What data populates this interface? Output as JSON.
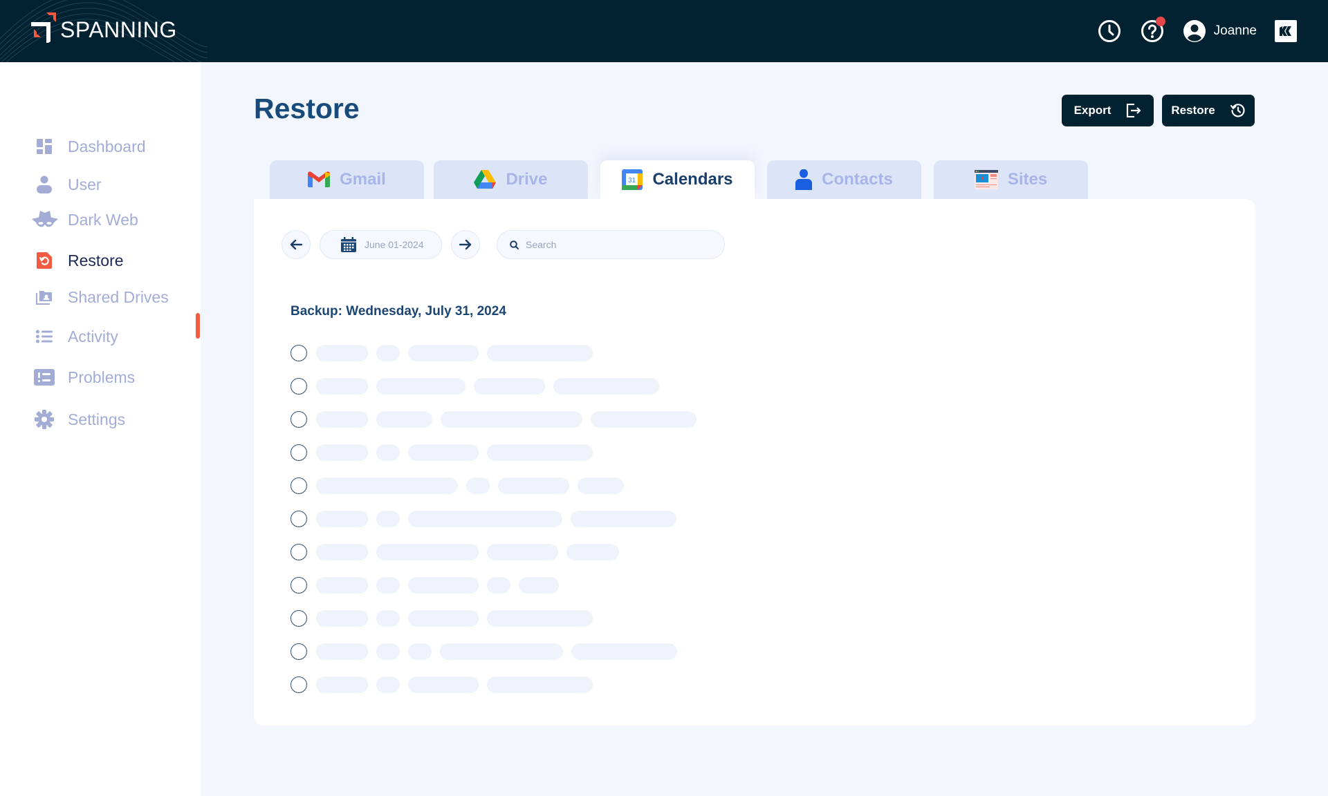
{
  "header": {
    "brand": "SPANNING",
    "icons": [
      "history-clock-icon",
      "help-question-icon",
      "user-avatar-icon",
      "kaseya-k-icon"
    ],
    "help_has_notification": true,
    "user_name": "Joanne",
    "colors": {
      "background": "#022232",
      "logo_accent": "#F25A41",
      "notification": "#E0484C"
    }
  },
  "sidebar": {
    "active": "Restore",
    "items": [
      {
        "label": "Dashboard",
        "icon": "dashboard-grid-icon"
      },
      {
        "label": "User",
        "icon": "user-icon"
      },
      {
        "label": "Dark Web",
        "icon": "spy-hat-icon"
      },
      {
        "label": "Restore",
        "icon": "restore-file-icon"
      },
      {
        "label": "Shared Drives",
        "icon": "shared-drives-icon"
      },
      {
        "label": "Activity",
        "icon": "activity-list-icon"
      },
      {
        "label": "Problems",
        "icon": "problems-list-icon"
      },
      {
        "label": "Settings",
        "icon": "settings-gear-icon"
      }
    ],
    "colors": {
      "inactive": "#A3ACD5",
      "active": "#1E2A55",
      "active_indicator": "#F25A41"
    }
  },
  "main": {
    "title": "Restore",
    "actions": {
      "export_label": "Export",
      "restore_label": "Restore"
    },
    "tabs": [
      {
        "label": "Gmail",
        "icon": "gmail-icon",
        "active": false
      },
      {
        "label": "Drive",
        "icon": "google-drive-icon",
        "active": false
      },
      {
        "label": "Calendars",
        "icon": "google-calendar-icon",
        "active": true
      },
      {
        "label": "Contacts",
        "icon": "contacts-person-icon",
        "active": false
      },
      {
        "label": "Sites",
        "icon": "google-sites-icon",
        "active": false
      }
    ],
    "calendar_icon_day": "31",
    "controls": {
      "date_value": "June 01-2024",
      "search_placeholder": "Search",
      "search_value": ""
    },
    "backup_heading": "Backup: Wednesday, July 31, 2024",
    "rows_loading": true,
    "row_count": 11
  }
}
